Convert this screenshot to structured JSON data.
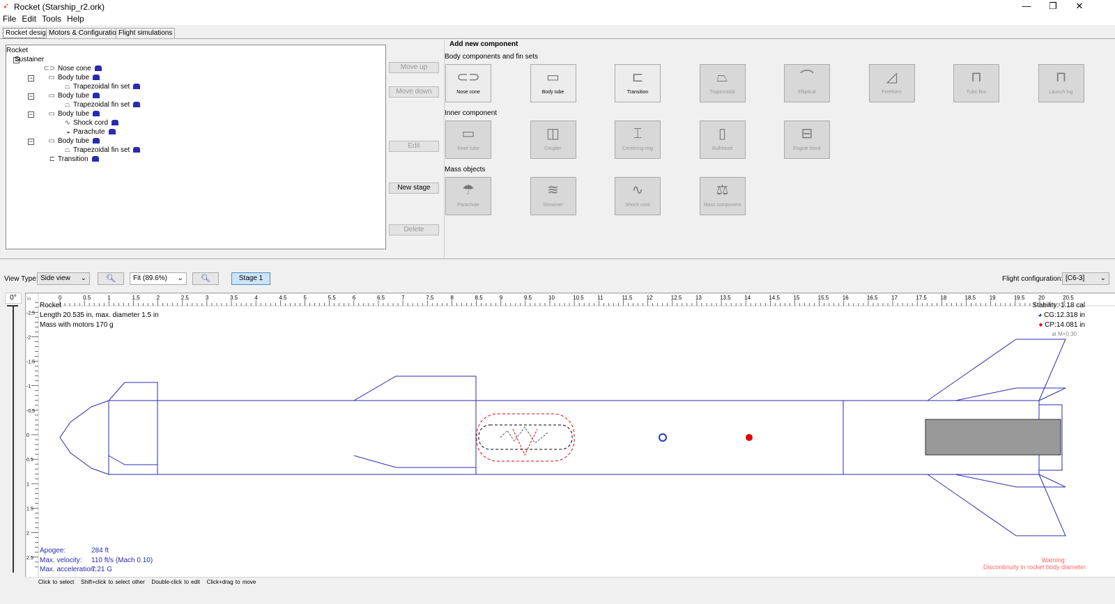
{
  "window": {
    "title": "Rocket (Starship_r2.ork)",
    "minimize": "—",
    "maximize": "❐",
    "close": "✕"
  },
  "menu": [
    "File",
    "Edit",
    "Tools",
    "Help"
  ],
  "tabs": [
    "Rocket design",
    "Motors & Configuration",
    "Flight simulations"
  ],
  "tree": [
    {
      "label": "Rocket",
      "level": 0
    },
    {
      "label": "Sustainer",
      "level": 1,
      "expand": "−"
    },
    {
      "label": "Nose cone",
      "level": 2,
      "icon": "nose"
    },
    {
      "label": "Body tube",
      "level": 2,
      "icon": "tube",
      "expand": "−"
    },
    {
      "label": "Trapezoidal fin set",
      "level": 3,
      "icon": "fin"
    },
    {
      "label": "Body tube",
      "level": 2,
      "icon": "tube",
      "expand": "−"
    },
    {
      "label": "Trapezoidal fin set",
      "level": 3,
      "icon": "fin"
    },
    {
      "label": "Body tube",
      "level": 2,
      "icon": "tube",
      "expand": "−"
    },
    {
      "label": "Shock cord",
      "level": 3,
      "icon": "cord"
    },
    {
      "label": "Parachute",
      "level": 3,
      "icon": "chute"
    },
    {
      "label": "Body tube",
      "level": 2,
      "icon": "tube",
      "expand": "−"
    },
    {
      "label": "Trapezoidal fin set",
      "level": 3,
      "icon": "fin"
    },
    {
      "label": "Transition",
      "level": 2,
      "icon": "transition"
    }
  ],
  "side_buttons": {
    "move_up": "Move up",
    "move_down": "Move down",
    "edit": "Edit",
    "new_stage": "New stage",
    "delete": "Delete"
  },
  "add_component": {
    "title": "Add new component",
    "sections": [
      {
        "label": "Body components and fin sets",
        "items": [
          {
            "label": "Nose cone",
            "enabled": true,
            "icon": "⊂⊃"
          },
          {
            "label": "Body tube",
            "enabled": true,
            "icon": "▭"
          },
          {
            "label": "Transition",
            "enabled": true,
            "icon": "⊏"
          },
          {
            "label": "Trapezoidal",
            "enabled": false,
            "icon": "⏢"
          },
          {
            "label": "Elliptical",
            "enabled": false,
            "icon": "⌒"
          },
          {
            "label": "Freeform",
            "enabled": false,
            "icon": "◿"
          },
          {
            "label": "Tube fins",
            "enabled": false,
            "icon": "⊓"
          },
          {
            "label": "Launch lug",
            "enabled": false,
            "icon": "⊓"
          }
        ]
      },
      {
        "label": "Inner component",
        "items": [
          {
            "label": "Inner tube",
            "enabled": false,
            "icon": "▭"
          },
          {
            "label": "Coupler",
            "enabled": false,
            "icon": "◫"
          },
          {
            "label": "Centering ring",
            "enabled": false,
            "icon": "⌶"
          },
          {
            "label": "Bulkhead",
            "enabled": false,
            "icon": "▯"
          },
          {
            "label": "Engine block",
            "enabled": false,
            "icon": "⊟"
          }
        ]
      },
      {
        "label": "Mass objects",
        "items": [
          {
            "label": "Parachute",
            "enabled": false,
            "icon": "☂"
          },
          {
            "label": "Streamer",
            "enabled": false,
            "icon": "≋"
          },
          {
            "label": "Shock cord",
            "enabled": false,
            "icon": "∿"
          },
          {
            "label": "Mass component",
            "enabled": false,
            "icon": "⚖"
          }
        ]
      }
    ]
  },
  "toolbar": {
    "view_type_label": "View Type:",
    "view_type": "Side view",
    "zoom_value": "Fit (89.6%)",
    "stage": "Stage 1",
    "flight_config_label": "Flight configuration:",
    "flight_config": "[C6-3]",
    "rotation": "0°",
    "unit": "in"
  },
  "ruler_x": [
    "0",
    "0.5",
    "1",
    "1.5",
    "2",
    "2.5",
    "3",
    "3.5",
    "4",
    "4.5",
    "5",
    "5.5",
    "6",
    "6.5",
    "7",
    "7.5",
    "8",
    "8.5",
    "9",
    "9.5",
    "10",
    "10.5",
    "11",
    "11.5",
    "12",
    "12.5",
    "13",
    "13.5",
    "14",
    "14.5",
    "15",
    "15.5",
    "16",
    "16.5",
    "17",
    "17.5",
    "18",
    "18.5",
    "19",
    "19.5",
    "20",
    "20.5"
  ],
  "ruler_y": [
    "-2.5",
    "-2",
    "-1.5",
    "-1",
    "-0.5",
    "0",
    "0.5",
    "1",
    "1.5",
    "2",
    "2.5"
  ],
  "rocket_info": {
    "name": "Rocket",
    "length": "Length 20.535 in, max. diameter 1.5 in",
    "mass": "Mass with motors 170 g"
  },
  "stability": {
    "stability": "Stability:  1.18 cal",
    "cg": "CG:12.318 in",
    "cp": "CP:14.081 in",
    "mach": "at M=0.30"
  },
  "flight": {
    "apogee_label": "Apogee:",
    "apogee": "284 ft",
    "velocity_label": "Max. velocity:",
    "velocity": "110 ft/s  (Mach 0.10)",
    "accel_label": "Max. acceleration:",
    "accel": "7.21 G"
  },
  "warning": {
    "title": "Warning:",
    "text": "Discontinuity in rocket body diameter."
  },
  "hints": [
    "Click to select",
    "Shift+click to select other",
    "Double-click to edit",
    "Click+drag to move"
  ],
  "colors": {
    "outline": "#2a2ab0",
    "cg": "#1a3cc8",
    "cp": "#e00000",
    "motor": "#999999"
  }
}
